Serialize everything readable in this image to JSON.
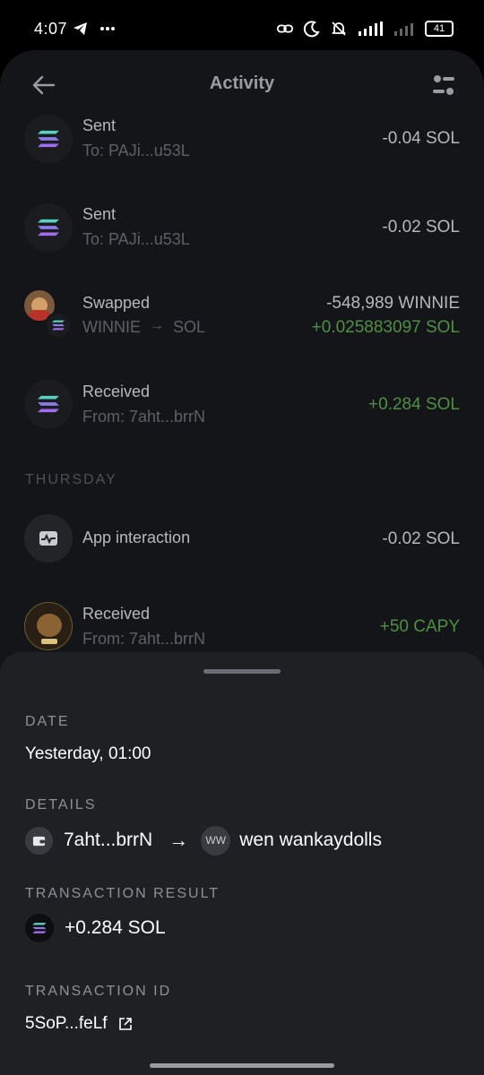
{
  "status_bar": {
    "time": "4:07",
    "battery": "41",
    "left_icons": [
      "telegram-icon",
      "more-dots-icon"
    ],
    "right_icons": [
      "link-icon",
      "moon-icon",
      "bell-off-icon",
      "signal-icon",
      "signal-icon",
      "battery-icon"
    ]
  },
  "header": {
    "title": "Activity"
  },
  "transactions": [
    {
      "title": "Sent",
      "sub": "To:  PAJi...u53L",
      "amount": "-0.04 SOL",
      "icon": "solana-icon"
    },
    {
      "title": "Sent",
      "sub": "To:  PAJi...u53L",
      "amount": "-0.02 SOL",
      "icon": "solana-icon"
    },
    {
      "title": "Swapped",
      "sub_from": "WINNIE",
      "sub_to": "SOL",
      "amount": "-548,989 WINNIE",
      "amount2": "+0.025883097 SOL",
      "icon": "winnie-token-avatar"
    },
    {
      "title": "Received",
      "sub": "From:  7aht...brrN",
      "amount": "+0.284 SOL",
      "icon": "solana-icon"
    }
  ],
  "section": "THURSDAY",
  "thursday_transactions": [
    {
      "title": "App interaction",
      "amount": "-0.02 SOL",
      "icon": "activity-icon"
    },
    {
      "title": "Received",
      "sub": "From:  7aht...brrN",
      "amount": "+50 CAPY",
      "icon": "capy-token-avatar"
    }
  ],
  "detail": {
    "date_label": "DATE",
    "date_value": "Yesterday, 01:00",
    "details_label": "DETAILS",
    "from": "7aht...brrN",
    "to_badge": "WW",
    "to": "wen wankaydolls",
    "result_label": "TRANSACTION RESULT",
    "result_value": "+0.284 SOL",
    "id_label": "TRANSACTION ID",
    "id_value": "5SoP...feLf"
  },
  "colors": {
    "background": "#141518",
    "sheet": "#1f2024",
    "positive": "#4f8f45",
    "muted": "#5d6068"
  }
}
